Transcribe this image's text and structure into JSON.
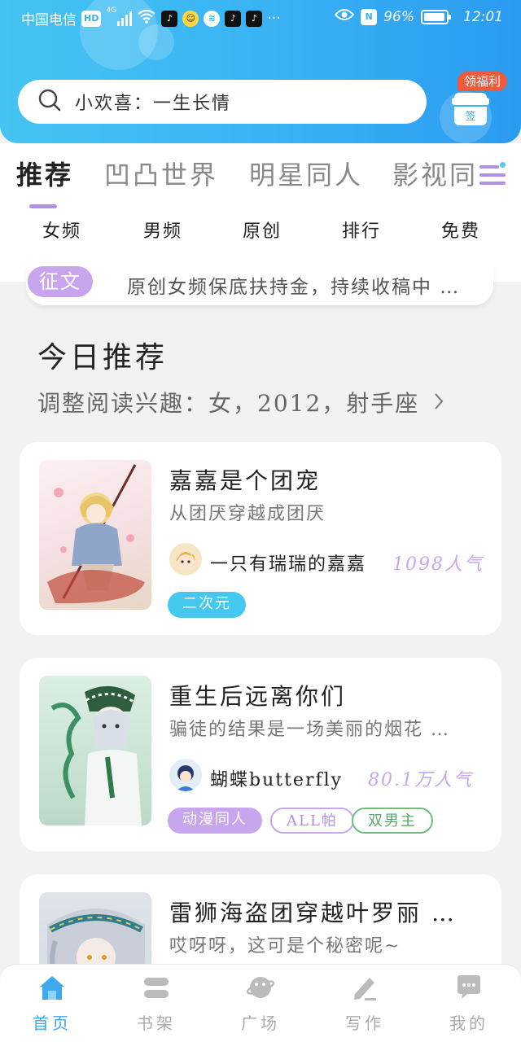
{
  "status_bar": {
    "carrier": "中国电信",
    "hd": "HD",
    "signal": "4G",
    "nfc": "N",
    "battery": "96%",
    "battery_level": 0.96,
    "time": "12:01"
  },
  "search": {
    "text": "小欢喜：一生长情"
  },
  "gift": {
    "badge": "领福利",
    "box_label": "签"
  },
  "tabs": [
    {
      "label": "推荐",
      "active": true
    },
    {
      "label": "凹凸世界",
      "active": false
    },
    {
      "label": "明星同人",
      "active": false
    },
    {
      "label": "影视同",
      "active": false
    }
  ],
  "subtabs": [
    "女频",
    "男频",
    "原创",
    "排行",
    "免费"
  ],
  "notice": {
    "badge": "征文",
    "text": "原创女频保底扶持金，持续收稿中 …"
  },
  "section": {
    "title": "今日推荐",
    "subtitle": "调整阅读兴趣：女，2012，射手座"
  },
  "books": [
    {
      "title": "嘉嘉是个团宠",
      "desc": "从团厌穿越成团厌",
      "author": "一只有瑞瑞的嘉嘉",
      "heat": "1098人气",
      "tags": [
        {
          "label": "二次元",
          "style": "filled-blue"
        }
      ]
    },
    {
      "title": "重生后远离你们",
      "desc": "骗徒的结果是一场美丽的烟花 …",
      "author": "蝴蝶butterfly",
      "heat": "80.1万人气",
      "tags": [
        {
          "label": "动漫同人",
          "style": "filled-purple"
        },
        {
          "label": "ALL帕",
          "style": "outline-purple"
        },
        {
          "label": "双男主",
          "style": "outline-green"
        }
      ]
    },
    {
      "title": "雷狮海盗团穿越叶罗丽 …",
      "desc": "哎呀呀，这可是个秘密呢~"
    }
  ],
  "bottom_nav": [
    {
      "label": "首页",
      "icon": "home-icon",
      "active": true
    },
    {
      "label": "书架",
      "icon": "bookshelf-icon",
      "active": false
    },
    {
      "label": "广场",
      "icon": "planet-icon",
      "active": false
    },
    {
      "label": "写作",
      "icon": "pen-icon",
      "active": false
    },
    {
      "label": "我的",
      "icon": "chat-bubble-icon",
      "active": false
    }
  ],
  "colors": {
    "header_gradient_start": "#45c4f2",
    "header_gradient_end": "#2a9bf0",
    "accent_purple": "#c7a6ee",
    "accent_blue": "#3aa9ee",
    "tag_green": "#6cbf7b"
  }
}
